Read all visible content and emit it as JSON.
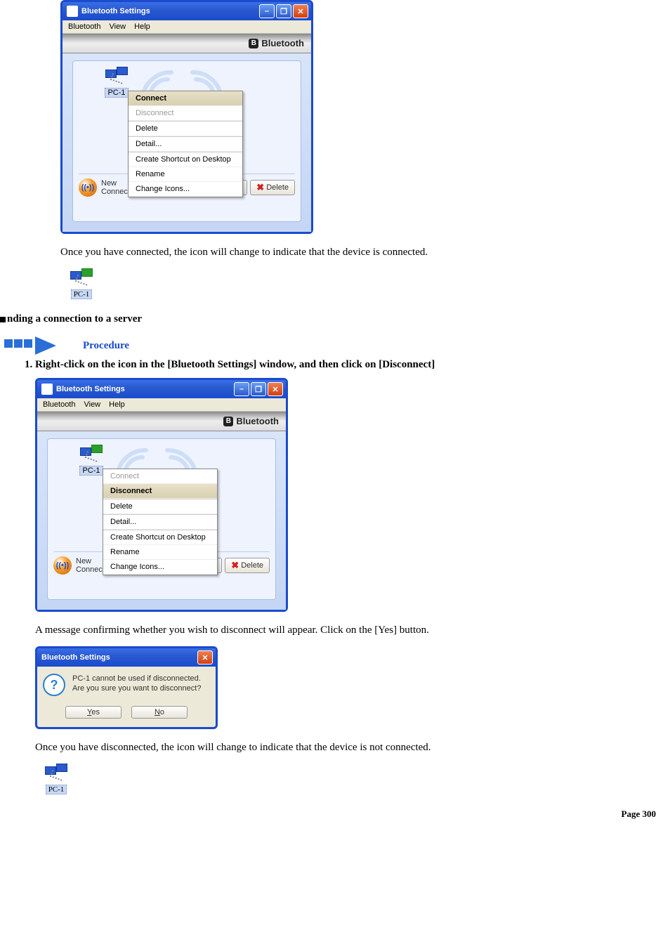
{
  "window": {
    "title": "Bluetooth Settings",
    "menus": [
      "Bluetooth",
      "View",
      "Help"
    ],
    "brand": "Bluetooth",
    "device_label": "PC-1",
    "new_connection": "New\nConnection",
    "detail_btn": "Detail...",
    "delete_btn": "Delete",
    "ctx_connect": {
      "hl": "Connect",
      "disabled": "Disconnect",
      "delete": "Delete",
      "detail": "Detail...",
      "shortcut": "Create Shortcut on Desktop",
      "rename": "Rename",
      "icons": "Change Icons..."
    },
    "ctx_disconnect": {
      "disabled": "Connect",
      "hl": "Disconnect",
      "delete": "Delete",
      "detail": "Detail...",
      "shortcut": "Create Shortcut on Desktop",
      "rename": "Rename",
      "icons": "Change Icons..."
    }
  },
  "text": {
    "after_connect": "Once you have connected, the icon will change to indicate that the device is connected.",
    "ending_heading": "nding a connection to a server",
    "procedure": "Procedure",
    "step1": "Right-click on the icon in the [Bluetooth Settings] window, and then click on [Disconnect]",
    "confirm_prompt": "A message confirming whether you wish to disconnect will appear. Click on the [Yes] button.",
    "after_disconnect": "Once you have disconnected, the icon will change to indicate that the device is not connected."
  },
  "dialog": {
    "title": "Bluetooth Settings",
    "line1": "PC-1 cannot be used if disconnected.",
    "line2": "Are you sure you want to disconnect?",
    "yes": "Yes",
    "no": "No"
  },
  "page": "Page 300"
}
